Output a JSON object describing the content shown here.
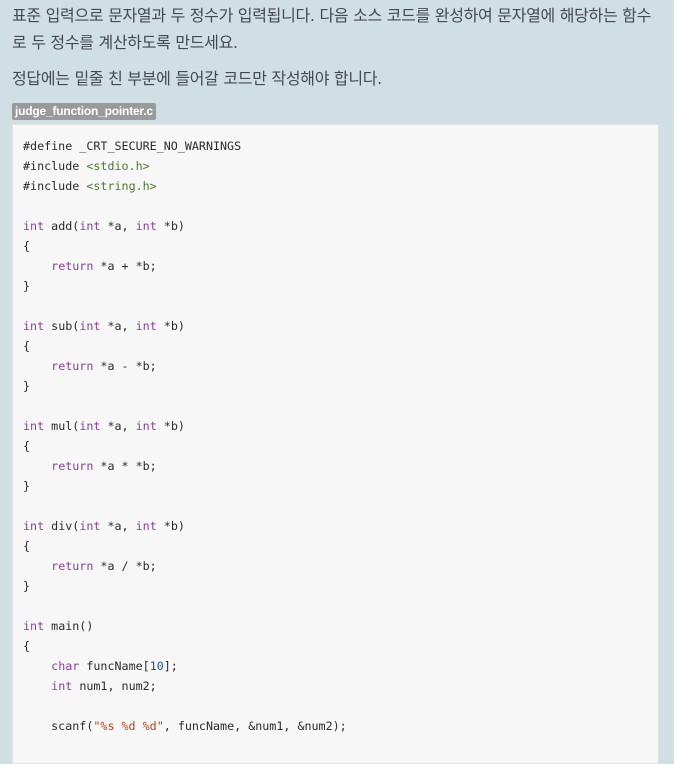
{
  "description": {
    "paragraph1": "표준 입력으로 문자열과 두 정수가 입력됩니다. 다음 소스 코드를 완성하여 문자열에 해당하는 함수로 두 정수를 계산하도록 만드세요.",
    "paragraph2": "정답에는 밑줄 친 부분에 들어갈 코드만 작성해야 합니다."
  },
  "file": {
    "name": "judge_function_pointer.c"
  },
  "code_lines": [
    [
      [
        "t",
        "#define _CRT_SECURE_NO_WARNINGS"
      ]
    ],
    [
      [
        "t",
        "#include "
      ],
      [
        "inc",
        "<stdio.h>"
      ]
    ],
    [
      [
        "t",
        "#include "
      ],
      [
        "inc",
        "<string.h>"
      ]
    ],
    [],
    [
      [
        "kw",
        "int"
      ],
      [
        "t",
        " add("
      ],
      [
        "kw",
        "int"
      ],
      [
        "t",
        " *a, "
      ],
      [
        "kw",
        "int"
      ],
      [
        "t",
        " *b)"
      ]
    ],
    [
      [
        "t",
        "{"
      ]
    ],
    [
      [
        "t",
        "    "
      ],
      [
        "kw",
        "return"
      ],
      [
        "t",
        " *a + *b;"
      ]
    ],
    [
      [
        "t",
        "}"
      ]
    ],
    [],
    [
      [
        "kw",
        "int"
      ],
      [
        "t",
        " sub("
      ],
      [
        "kw",
        "int"
      ],
      [
        "t",
        " *a, "
      ],
      [
        "kw",
        "int"
      ],
      [
        "t",
        " *b)"
      ]
    ],
    [
      [
        "t",
        "{"
      ]
    ],
    [
      [
        "t",
        "    "
      ],
      [
        "kw",
        "return"
      ],
      [
        "t",
        " *a - *b;"
      ]
    ],
    [
      [
        "t",
        "}"
      ]
    ],
    [],
    [
      [
        "kw",
        "int"
      ],
      [
        "t",
        " mul("
      ],
      [
        "kw",
        "int"
      ],
      [
        "t",
        " *a, "
      ],
      [
        "kw",
        "int"
      ],
      [
        "t",
        " *b)"
      ]
    ],
    [
      [
        "t",
        "{"
      ]
    ],
    [
      [
        "t",
        "    "
      ],
      [
        "kw",
        "return"
      ],
      [
        "t",
        " *a * *b;"
      ]
    ],
    [
      [
        "t",
        "}"
      ]
    ],
    [],
    [
      [
        "kw",
        "int"
      ],
      [
        "t",
        " div("
      ],
      [
        "kw",
        "int"
      ],
      [
        "t",
        " *a, "
      ],
      [
        "kw",
        "int"
      ],
      [
        "t",
        " *b)"
      ]
    ],
    [
      [
        "t",
        "{"
      ]
    ],
    [
      [
        "t",
        "    "
      ],
      [
        "kw",
        "return"
      ],
      [
        "t",
        " *a / *b;"
      ]
    ],
    [
      [
        "t",
        "}"
      ]
    ],
    [],
    [
      [
        "kw",
        "int"
      ],
      [
        "t",
        " main()"
      ]
    ],
    [
      [
        "t",
        "{"
      ]
    ],
    [
      [
        "t",
        "    "
      ],
      [
        "kw",
        "char"
      ],
      [
        "t",
        " funcName["
      ],
      [
        "num",
        "10"
      ],
      [
        "t",
        "];"
      ]
    ],
    [
      [
        "t",
        "    "
      ],
      [
        "kw",
        "int"
      ],
      [
        "t",
        " num1, num2;"
      ]
    ],
    [],
    [
      [
        "t",
        "    scanf("
      ],
      [
        "str",
        "\"%s %d %d\""
      ],
      [
        "t",
        ", funcName, &num1, &num2);"
      ]
    ]
  ]
}
